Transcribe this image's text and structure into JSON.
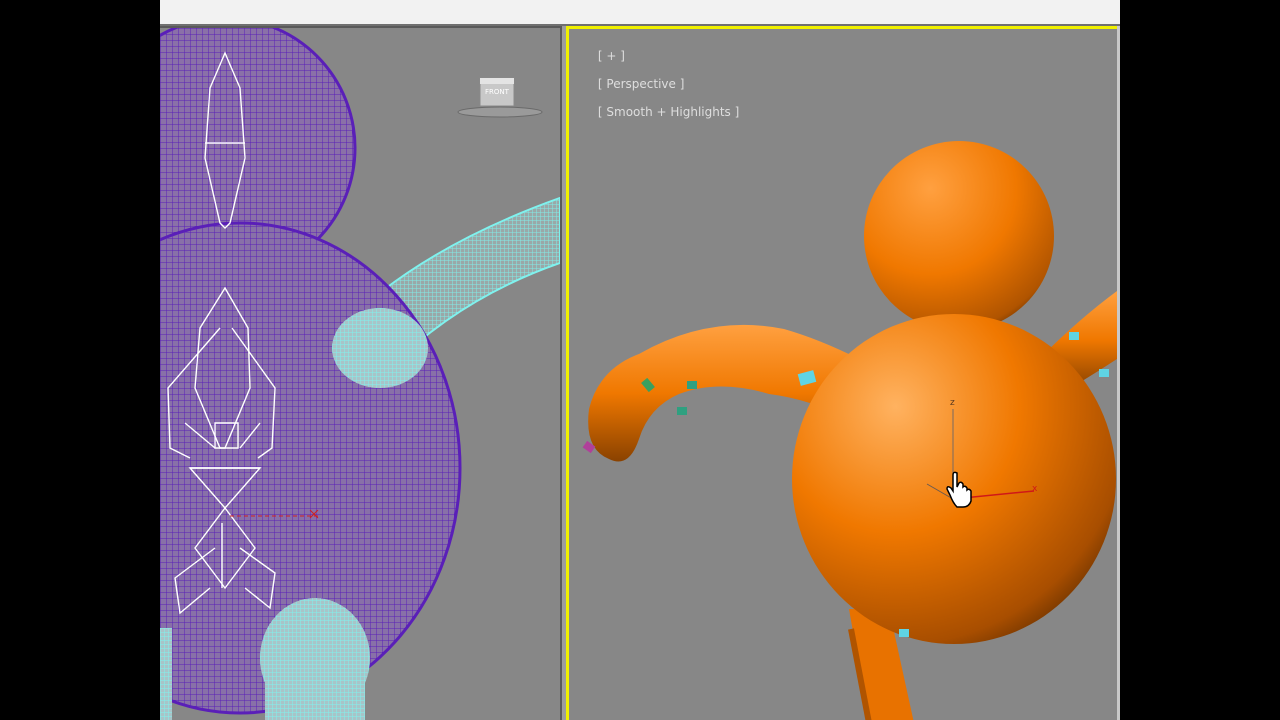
{
  "viewports": {
    "front": {
      "viewcube_label": "FRONT"
    },
    "perspective": {
      "label_plus": "[ + ]",
      "label_view": "[ Perspective ]",
      "label_shading": "[ Smooth + Highlights ]",
      "gizmo_z": "z",
      "gizmo_x": "x"
    }
  },
  "colors": {
    "viewport_bg": "#878787",
    "active_border": "#f0f000",
    "wire_body": "#5a1fb8",
    "wire_limb": "#7ff2ee",
    "bone": "#ffffff",
    "mesh_orange": "#f07800"
  },
  "icons": {
    "cursor": "hand-pointer-icon"
  }
}
